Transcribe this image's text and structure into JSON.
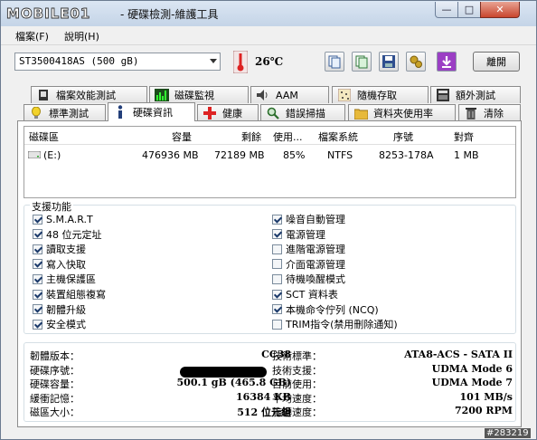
{
  "window": {
    "logo_text": "MOBILE01",
    "title": "- 硬碟檢測-維護工具",
    "minimize": "—",
    "maximize": "□",
    "close": "✕"
  },
  "menu": {
    "items": [
      "檔案(F)",
      "說明(H)"
    ]
  },
  "toolbar": {
    "device": "ST3500418AS (500 gB)",
    "temperature": "26℃",
    "buttons": [
      "copy-icon",
      "copy-text-icon",
      "save-icon",
      "settings-icon",
      "download-icon"
    ],
    "exit_label": "離開"
  },
  "tabs_top": [
    {
      "label": "檔案效能測試",
      "icon": "benchmark-icon"
    },
    {
      "label": "磁碟監視",
      "icon": "monitor-icon"
    },
    {
      "label": "AAM",
      "icon": "speaker-icon"
    },
    {
      "label": "隨機存取",
      "icon": "random-access-icon"
    },
    {
      "label": "額外測試",
      "icon": "extra-test-icon"
    }
  ],
  "tabs_bottom": [
    {
      "label": "標準測試",
      "icon": "lightbulb-icon"
    },
    {
      "label": "硬碟資訊",
      "icon": "info-icon",
      "active": true
    },
    {
      "label": "健康",
      "icon": "health-icon"
    },
    {
      "label": "錯誤掃描",
      "icon": "search-icon"
    },
    {
      "label": "資料夾使用率",
      "icon": "folder-icon"
    },
    {
      "label": "清除",
      "icon": "trash-icon"
    }
  ],
  "partitions": {
    "columns": [
      "磁碟區",
      "容量",
      "剩餘",
      "使用...",
      "檔案系統",
      "序號",
      "對齊"
    ],
    "rows": [
      {
        "volume": "(E:)",
        "capacity": "476936 MB",
        "free": "72189 MB",
        "used": "85%",
        "fs": "NTFS",
        "serial": "8253-178A",
        "align": "1 MB"
      }
    ]
  },
  "features": {
    "title": "支援功能",
    "left": [
      {
        "label": "S.M.A.R.T",
        "checked": true
      },
      {
        "label": "48 位元定址",
        "checked": true
      },
      {
        "label": "讀取支援",
        "checked": true
      },
      {
        "label": "寫入快取",
        "checked": true
      },
      {
        "label": "主機保護區",
        "checked": true
      },
      {
        "label": "裝置組態複寫",
        "checked": true
      },
      {
        "label": "韌體升級",
        "checked": true
      },
      {
        "label": "安全模式",
        "checked": true
      }
    ],
    "right": [
      {
        "label": "噪音自動管理",
        "checked": true
      },
      {
        "label": "電源管理",
        "checked": true
      },
      {
        "label": "進階電源管理",
        "checked": false
      },
      {
        "label": "介面電源管理",
        "checked": false
      },
      {
        "label": "待機喚醒模式",
        "checked": false
      },
      {
        "label": "SCT 資料表",
        "checked": true
      },
      {
        "label": "本機命令佇列 (NCQ)",
        "checked": true
      },
      {
        "label": "TRIM指令(禁用刪除通知)",
        "checked": false
      }
    ]
  },
  "info": {
    "left": [
      {
        "label": "韌體版本：",
        "value": "CC38"
      },
      {
        "label": "硬碟序號：",
        "value": ""
      },
      {
        "label": "硬碟容量：",
        "value": "500.1 gB (465.8 GB)"
      },
      {
        "label": "緩衝記憶：",
        "value": "16384 KB"
      },
      {
        "label": "磁區大小：",
        "value": "512 位元組"
      }
    ],
    "right": [
      {
        "label": "技術標準：",
        "value": "ATA8-ACS - SATA II"
      },
      {
        "label": "技術支援：",
        "value": "UDMA Mode 6"
      },
      {
        "label": "目前使用：",
        "value": "UDMA Mode 7"
      },
      {
        "label": "平均速度：",
        "value": "101 MB/s"
      },
      {
        "label": "旋轉速度：",
        "value": "7200 RPM"
      }
    ]
  },
  "watermark": "#283219"
}
